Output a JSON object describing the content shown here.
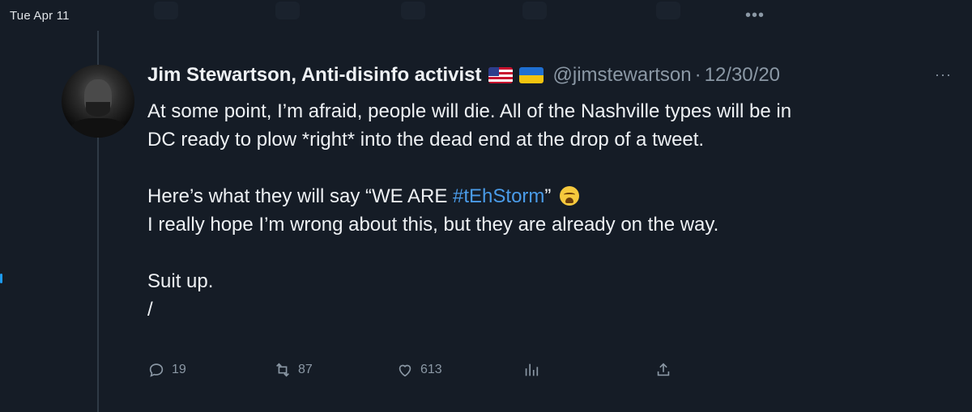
{
  "date_label": "Tue Apr 11",
  "top_more_label": "•••",
  "tweet": {
    "author_name": "Jim Stewartson, Anti-disinfo activist",
    "flags": [
      "us-flag",
      "ukraine-flag"
    ],
    "handle": "@jimstewartson",
    "separator": "·",
    "time": "12/30/20",
    "more_label": "···",
    "body": {
      "line1": "At some point, I’m afraid, people will die. All of the Nashville types will be in",
      "line2": "DC ready to plow *right* into the dead end at the drop of a tweet.",
      "line3_prefix": "Here’s what they will say “WE ARE ",
      "line3_hashtag": "#tEhStorm",
      "line3_suffix": "”",
      "line3_emoji": "weary-face",
      "line4": "I really hope I’m wrong about this, but they are already on the way.",
      "line5": "Suit up.",
      "line6": "/"
    },
    "actions": {
      "replies": "19",
      "retweets": "87",
      "likes": "613",
      "views_icon": "chart-icon",
      "share_icon": "share-icon"
    }
  },
  "colors": {
    "background": "#151c26",
    "text": "#eef1f4",
    "muted": "#8b98a5",
    "hashtag": "#4a9be8"
  }
}
